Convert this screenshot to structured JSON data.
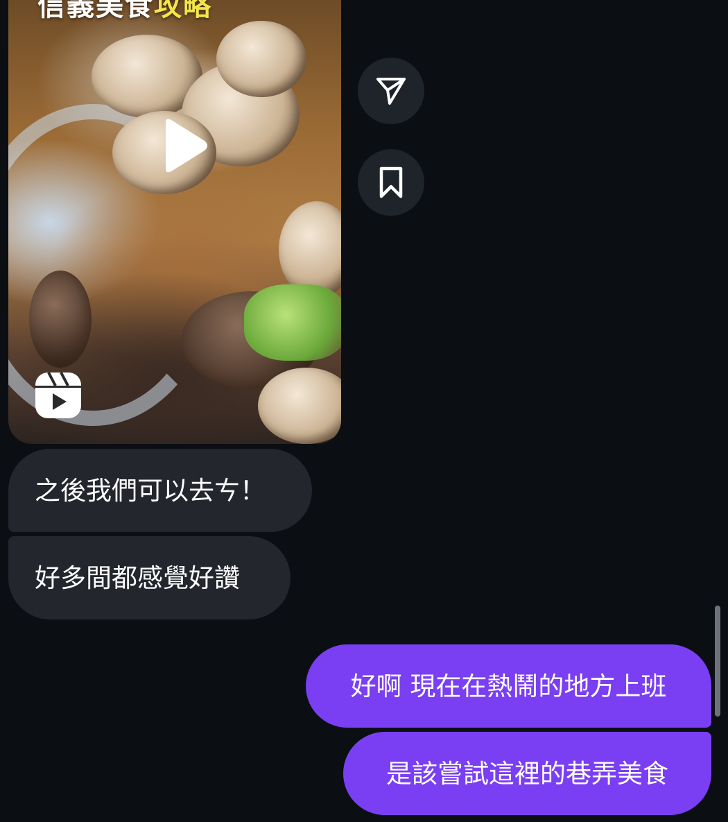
{
  "reel": {
    "caption_prefix": "信義美食",
    "caption_highlight": "攻略",
    "play_icon": "play-icon",
    "reels_icon": "reels-icon"
  },
  "actions": {
    "share_icon": "paper-plane-icon",
    "save_icon": "bookmark-icon"
  },
  "messages": [
    {
      "direction": "incoming",
      "text": "之後我們可以去ㄘ！"
    },
    {
      "direction": "incoming",
      "text": "好多間都感覺好讚"
    },
    {
      "direction": "outgoing",
      "text": "好啊 現在在熱鬧的地方上班"
    },
    {
      "direction": "outgoing",
      "text": "是該嘗試這裡的巷弄美食"
    }
  ],
  "colors": {
    "background": "#0b0f14",
    "incoming_bubble": "#23262d",
    "outgoing_bubble": "#7a3ff2",
    "action_button": "#1f232a"
  }
}
